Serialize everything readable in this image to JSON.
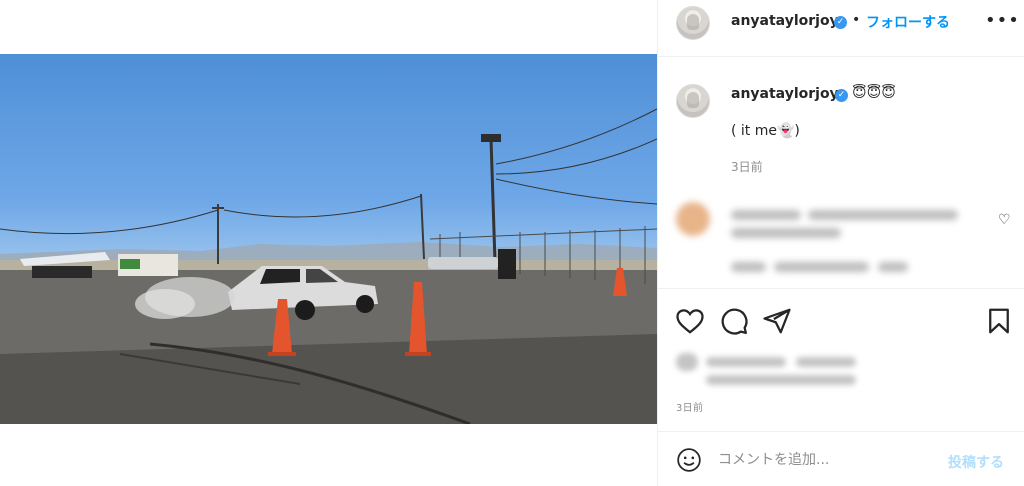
{
  "header": {
    "username": "anyataylorjoy",
    "verified_mark": "✓",
    "separator": "•",
    "follow_label": "フォローする",
    "more_label": "•••"
  },
  "caption": {
    "username": "anyataylorjoy",
    "verified_mark": "✓",
    "emojis": "😇😇😇",
    "text": "( it me👻)",
    "time": "3日前"
  },
  "actions": {
    "icons": [
      "heart-icon",
      "comment-icon",
      "share-icon",
      "bookmark-icon"
    ],
    "post_time": "3日前"
  },
  "comment_box": {
    "placeholder": "コメントを追加...",
    "post_label": "投稿する"
  },
  "colors": {
    "accent": "#0095f6",
    "verified": "#3897f0",
    "muted": "#8e8e8e",
    "post_disabled": "#b2dffc"
  }
}
